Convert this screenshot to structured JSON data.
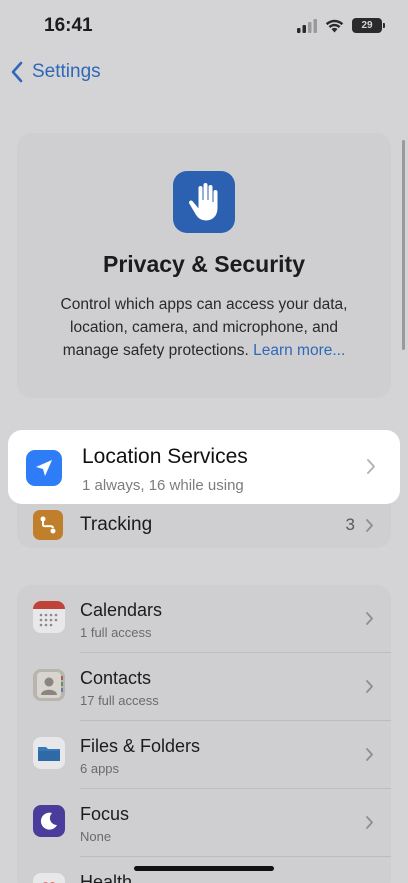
{
  "status_bar": {
    "time": "16:41",
    "battery": "29"
  },
  "nav": {
    "back_label": "Settings"
  },
  "hero": {
    "title": "Privacy & Security",
    "description": "Control which apps can access your data, location, camera, and microphone, and manage safety protections.",
    "link": "Learn more..."
  },
  "location_services": {
    "title": "Location Services",
    "subtitle": "1 always, 16 while using"
  },
  "tracking": {
    "label": "Tracking",
    "count": "3"
  },
  "items": [
    {
      "title": "Calendars",
      "subtitle": "1 full access",
      "icon": "calendar-icon"
    },
    {
      "title": "Contacts",
      "subtitle": "17 full access",
      "icon": "contacts-icon"
    },
    {
      "title": "Files & Folders",
      "subtitle": "6 apps",
      "icon": "folder-icon"
    },
    {
      "title": "Focus",
      "subtitle": "None",
      "icon": "moon-icon"
    },
    {
      "title": "Health",
      "subtitle": "",
      "icon": "heart-icon"
    }
  ],
  "colors": {
    "accent": "#2f68b8",
    "location_icon_bg": "#2f7df6",
    "tracking_icon_bg": "#c07f2a",
    "privacy_icon_bg": "#2b61b0"
  }
}
